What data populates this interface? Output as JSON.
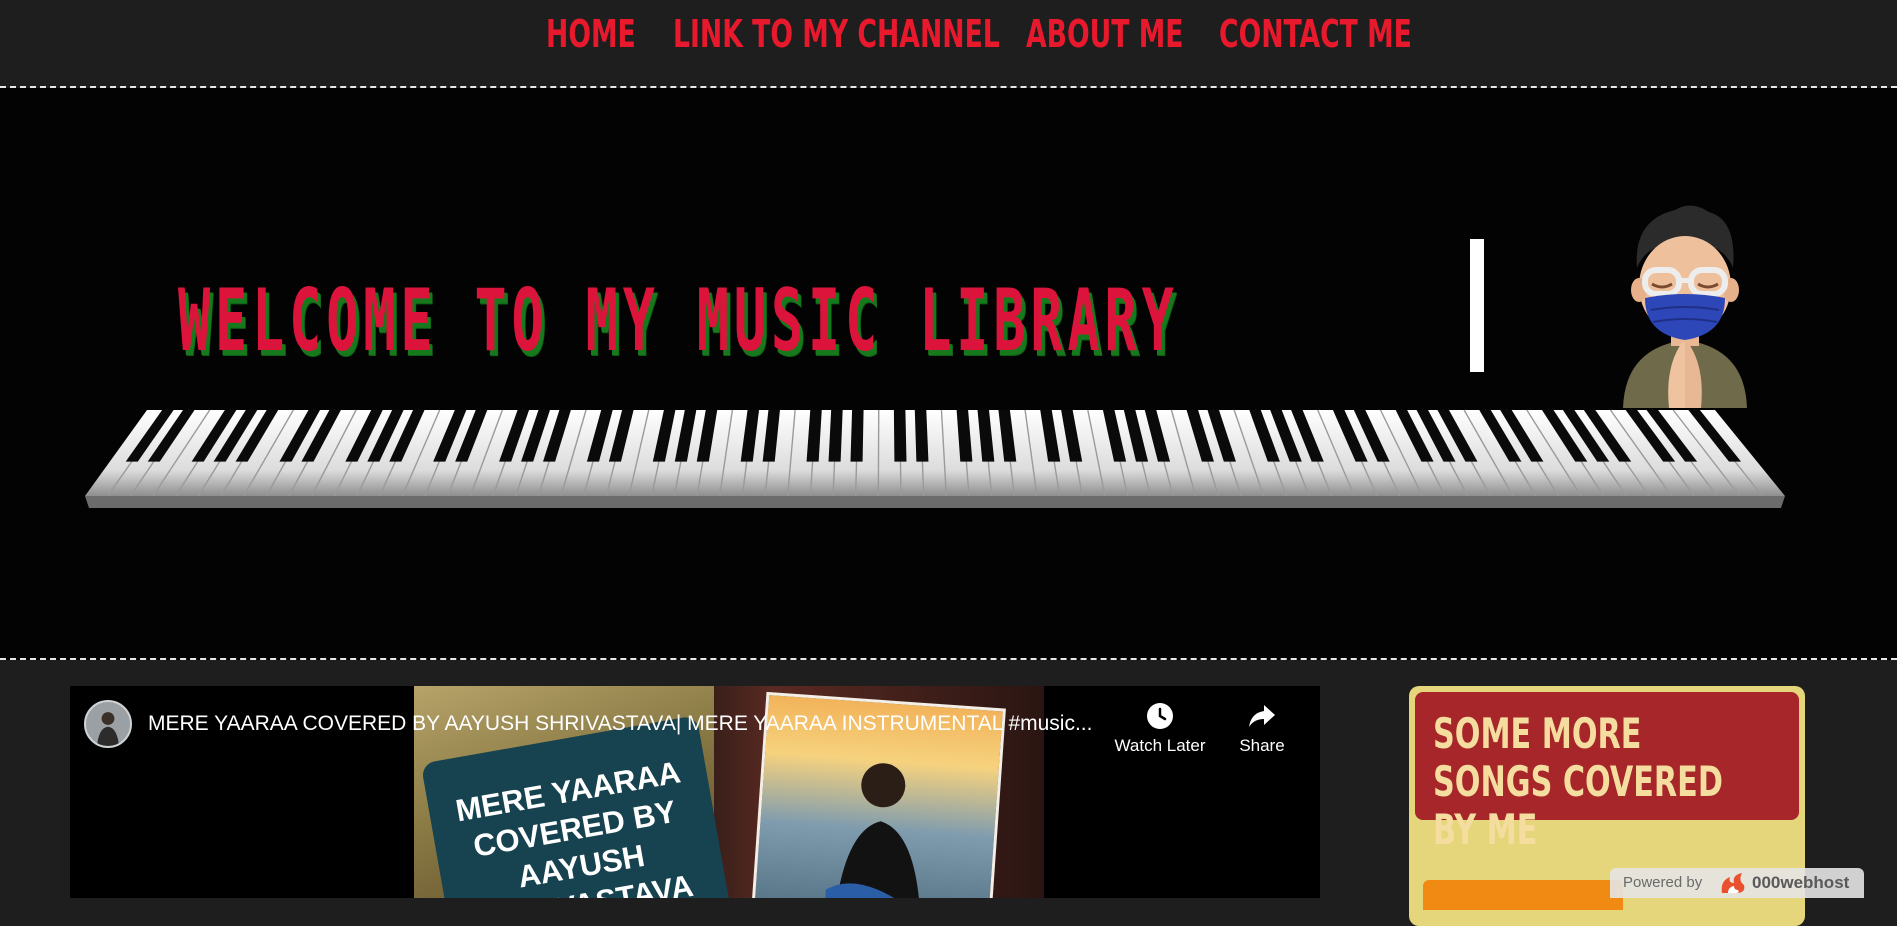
{
  "nav": {
    "items": [
      "HOME",
      "LINK TO MY CHANNEL",
      "ABOUT ME",
      "CONTACT ME"
    ]
  },
  "hero": {
    "title": "WELCOME TO MY MUSIC LIBRARY"
  },
  "video": {
    "title": "MERE YAARAA COVERED BY AAYUSH SHRIVASTAVA| MERE YAARAA INSTRUMENTAL #music...",
    "thumbnail_text": "MERE YAARAA COVERED BY AAYUSH SHRIVASTAVA",
    "watch_later_label": "Watch Later",
    "share_label": "Share"
  },
  "sidebar": {
    "title": "SOME MORE SONGS COVERED BY ME"
  },
  "footer_badge": {
    "label": "Powered by",
    "brand": "000webhost"
  },
  "colors": {
    "accent_red": "#e8192c",
    "title_red": "#dc143c",
    "title_shadow_green": "#167a1c",
    "sidebar_bg": "#e6d67b",
    "sidebar_head": "#a6262a",
    "page_bg": "#1e1e1e"
  },
  "icons": [
    "clock-icon",
    "share-arrow-icon",
    "fire-logo-icon",
    "piano-keyboard",
    "memoji-avatar"
  ]
}
